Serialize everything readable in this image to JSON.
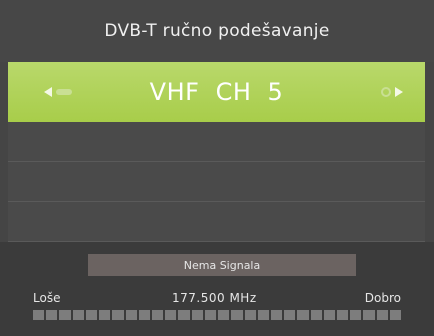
{
  "screen": {
    "title": "DVB-T ručno podešavanje"
  },
  "channel": {
    "band": "VHF",
    "label": "CH",
    "number": "5"
  },
  "signal": {
    "status": "Nema Signala",
    "quality_low_label": "Loše",
    "frequency": "177.500 MHz",
    "quality_high_label": "Dobro",
    "level_fraction": 0,
    "segments": 28
  },
  "colors": {
    "accent": "#a8cd4a",
    "background": "#454545",
    "status_box": "#6b6361"
  }
}
